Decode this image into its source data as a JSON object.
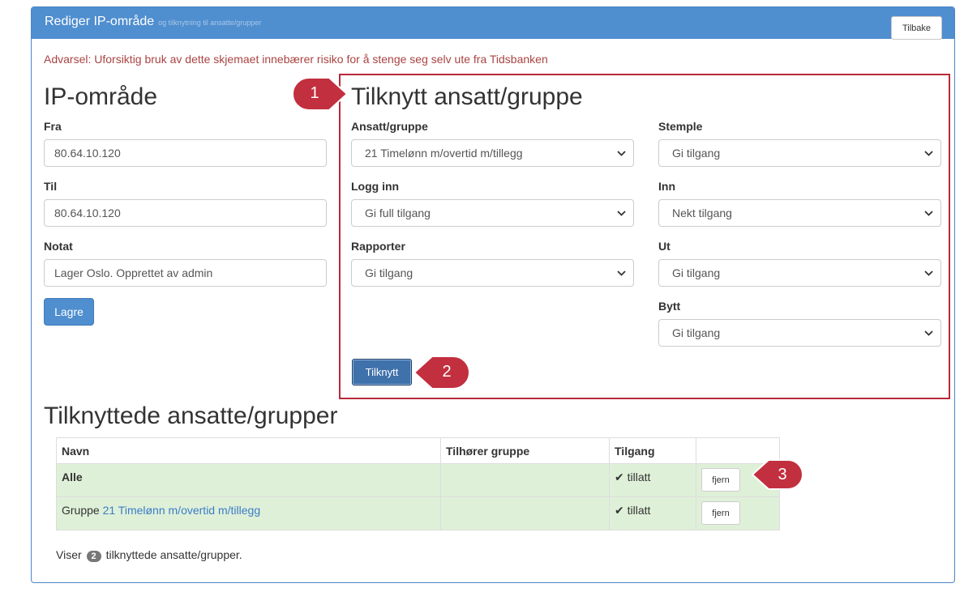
{
  "header": {
    "title": "Rediger IP-område",
    "subtitle": "og tilknytning til ansatte/grupper",
    "back_label": "Tilbake"
  },
  "warning": "Advarsel: Uforsiktig bruk av dette skjemaet innebærer risiko for å stenge seg selv ute fra Tidsbanken",
  "ip_range": {
    "heading": "IP-område",
    "from_label": "Fra",
    "from_value": "80.64.10.120",
    "to_label": "Til",
    "to_value": "80.64.10.120",
    "note_label": "Notat",
    "note_value": "Lager Oslo. Opprettet av admin",
    "save_label": "Lagre"
  },
  "connect": {
    "heading": "Tilknytt ansatt/gruppe",
    "employee_label": "Ansatt/gruppe",
    "employee_value": "21 Timelønn m/overtid m/tillegg",
    "stamp_label": "Stemple",
    "stamp_value": "Gi tilgang",
    "login_label": "Logg inn",
    "login_value": "Gi full tilgang",
    "in_label": "Inn",
    "in_value": "Nekt tilgang",
    "reports_label": "Rapporter",
    "reports_value": "Gi tilgang",
    "out_label": "Ut",
    "out_value": "Gi tilgang",
    "swap_label": "Bytt",
    "swap_value": "Gi tilgang",
    "submit_label": "Tilknytt"
  },
  "callouts": [
    "1",
    "2",
    "3"
  ],
  "connected": {
    "heading": "Tilknyttede ansatte/grupper",
    "columns": [
      "Navn",
      "Tilhører gruppe",
      "Tilgang",
      ""
    ],
    "rows": [
      {
        "name": "Alle",
        "group": "",
        "access": "tillatt",
        "action": "fjern"
      },
      {
        "prefix": "Gruppe",
        "name": "21 Timelønn m/overtid m/tillegg",
        "group": "",
        "access": "tillatt",
        "action": "fjern"
      }
    ],
    "footer_prefix": "Viser",
    "footer_count": "2",
    "footer_suffix": "tilknyttede ansatte/grupper."
  },
  "colors": {
    "header_bg": "#4f8ecf",
    "warning": "#a94442",
    "highlight_border": "#b8293a",
    "callout": "#c22f3f",
    "row_success": "#dff0d8"
  }
}
